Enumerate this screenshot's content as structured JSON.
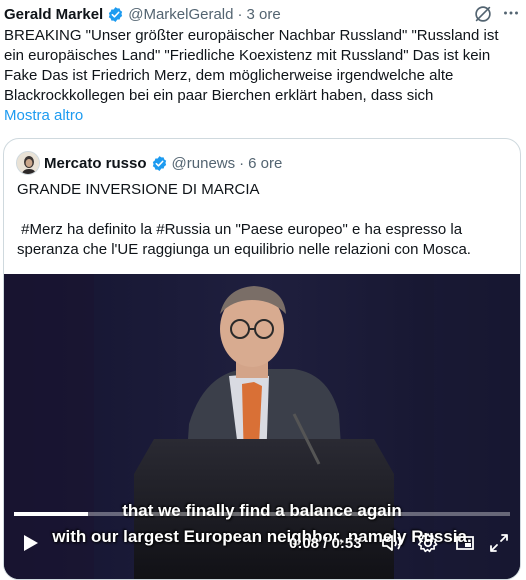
{
  "tweet": {
    "author_name": "Gerald Markel",
    "handle": "@MarkelGerald",
    "separator": "·",
    "time": "3 ore",
    "text": "BREAKING \"Unser größter europäischer Nachbar Russland\" \"Russland ist ein europäisches Land\" \"Friedliche Koexistenz mit Russland\" Das ist kein Fake Das ist Friedrich Merz, dem möglicherweise irgendwelche alte Blackrockkollegen bei ein paar Bierchen erklärt haben, dass sich",
    "show_more": "Mostra altro"
  },
  "quote": {
    "author_name": "Mercato russo",
    "handle": "@runews",
    "separator": "·",
    "time": "6 ore",
    "title": "GRANDE INVERSIONE DI MARCIA",
    "text": " #Merz ha definito la #Russia un \"Paese europeo\" e ha espresso la speranza che l'UE raggiunga un equilibrio nelle relazioni con Mosca."
  },
  "video": {
    "subtitle_line1": "that we finally find a balance again",
    "subtitle_line2": "with our largest European neighbor, namely Russia.",
    "time_display": "0:08 / 0:53",
    "progress": 0.15
  },
  "colors": {
    "accent": "#1d9bf0",
    "muted": "#536471",
    "border": "#cfd9de"
  },
  "icons": [
    "verified-badge-icon",
    "grok-icon",
    "more-icon",
    "play-icon",
    "volume-icon",
    "settings-icon",
    "pip-icon",
    "fullscreen-icon"
  ]
}
